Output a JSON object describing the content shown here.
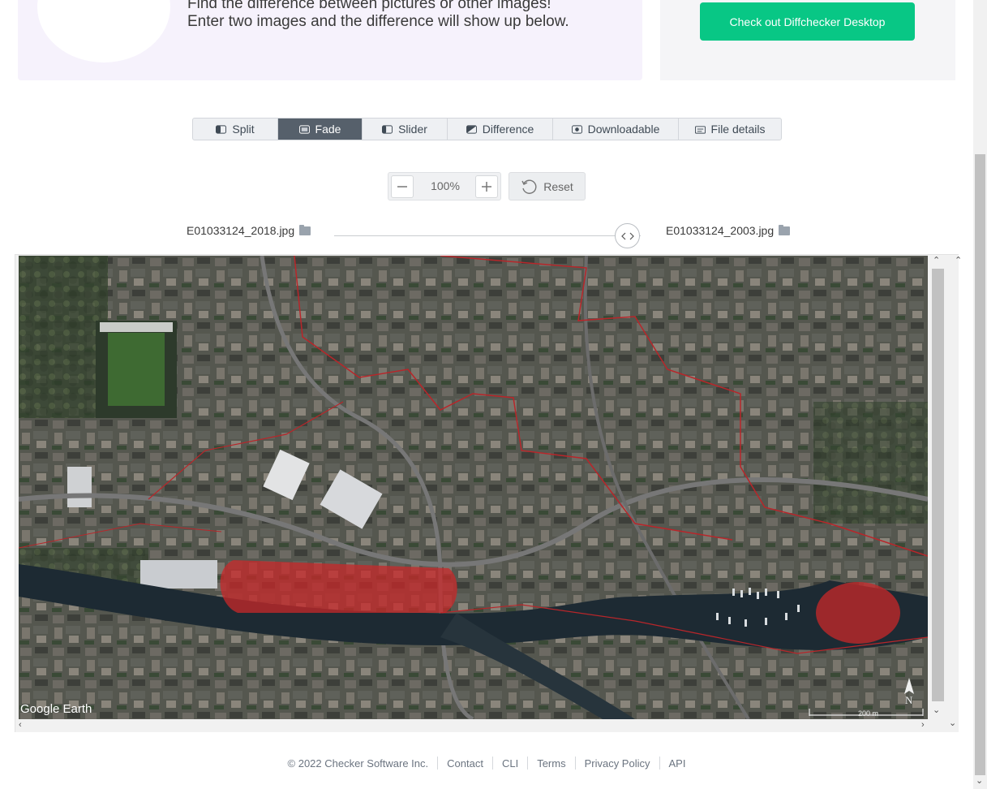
{
  "banner": {
    "line1": "Find the difference between pictures or other images!",
    "line2": "Enter two images and the difference will show up below."
  },
  "promo": {
    "button_label": "Check out Diffchecker Desktop"
  },
  "tabs": [
    {
      "label": "Split",
      "icon": "split-icon",
      "active": false
    },
    {
      "label": "Fade",
      "icon": "fade-icon",
      "active": true
    },
    {
      "label": "Slider",
      "icon": "slider-icon",
      "active": false
    },
    {
      "label": "Difference",
      "icon": "difference-icon",
      "active": false
    },
    {
      "label": "Downloadable",
      "icon": "download-icon",
      "active": false
    },
    {
      "label": "File details",
      "icon": "file-details-icon",
      "active": false
    }
  ],
  "zoom": {
    "value": "100%",
    "reset_label": "Reset"
  },
  "files": {
    "left": "E01033124_2018.jpg",
    "right": "E01033124_2003.jpg"
  },
  "map": {
    "watermark": "Google Earth",
    "scale": "200 m",
    "north": "N"
  },
  "footer": {
    "copyright": "© 2022 Checker Software Inc.",
    "links": [
      "Contact",
      "CLI",
      "Terms",
      "Privacy Policy",
      "API"
    ]
  },
  "colors": {
    "accent": "#08c785",
    "active_tab": "#56606b",
    "highlight": "#c8282a"
  }
}
